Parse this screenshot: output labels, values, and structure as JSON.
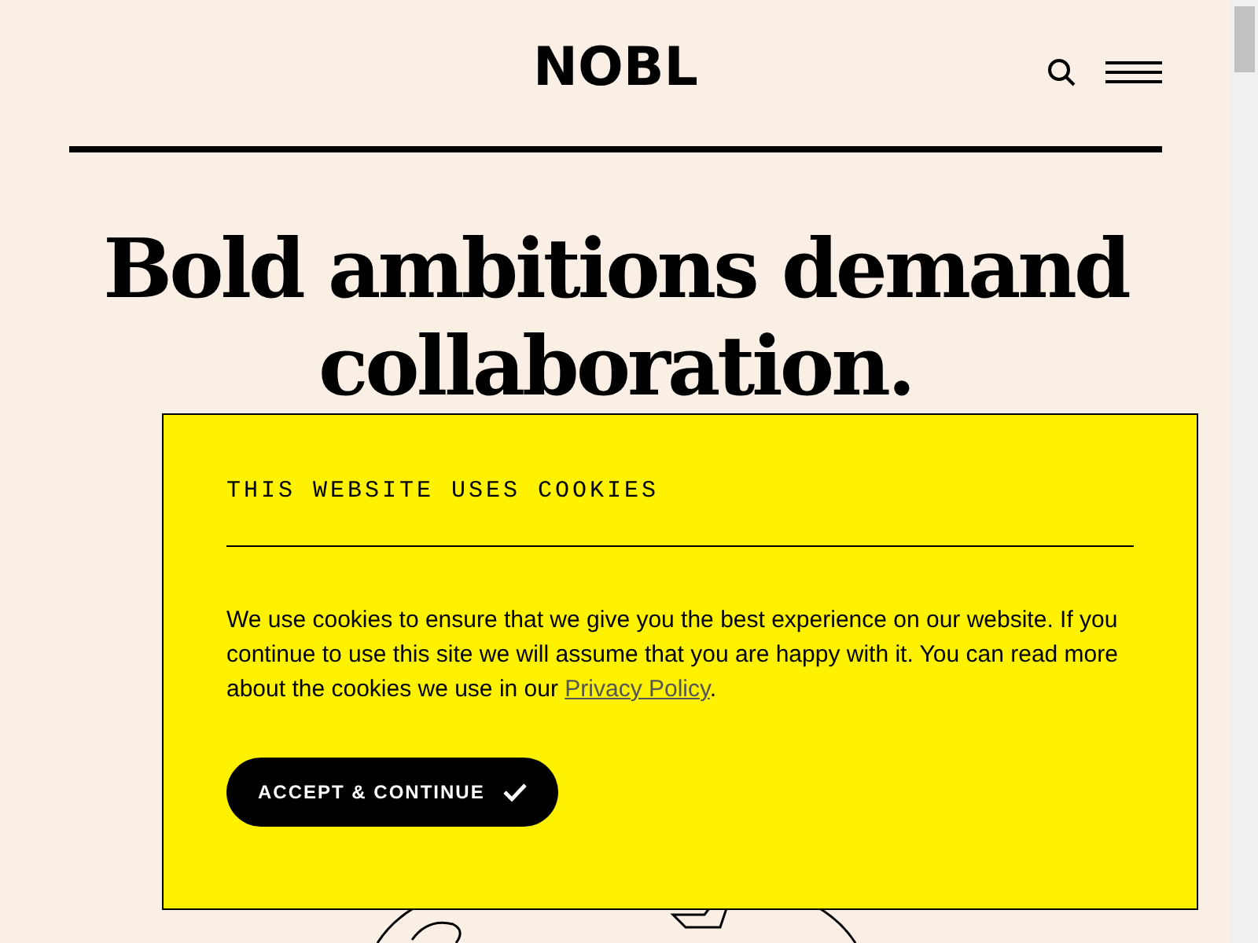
{
  "header": {
    "logo": "NOBL"
  },
  "hero": {
    "heading_lines": [
      "Bold ambitions demand",
      "collaboration."
    ]
  },
  "cookie_banner": {
    "title": "THIS WEBSITE USES COOKIES",
    "body": "We use cookies to ensure that we give you the best experience on our website. If you continue to use this site we will assume that you are happy with it. You can read more about the cookies we use in our ",
    "link": "Privacy Policy",
    "body_end": ".",
    "button": "ACCEPT & CONTINUE"
  }
}
